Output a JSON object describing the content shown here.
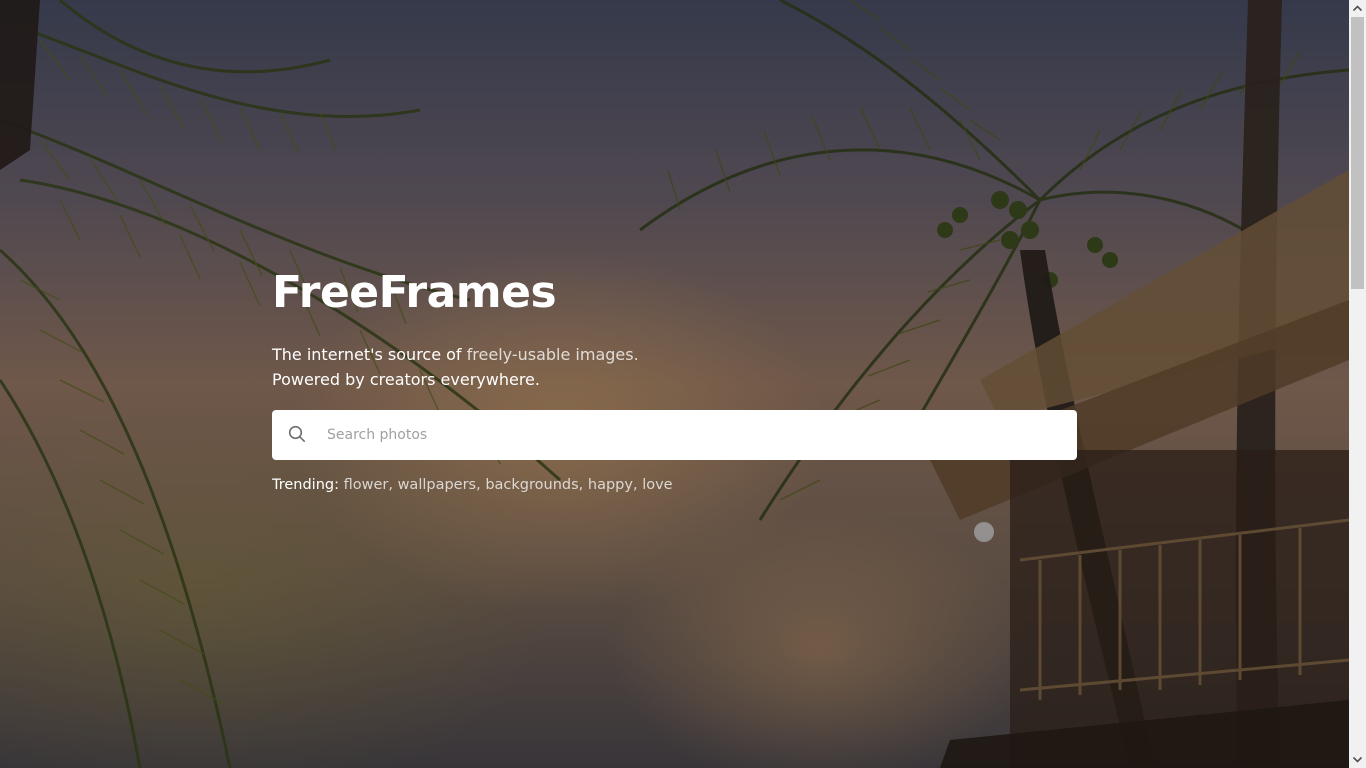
{
  "hero": {
    "brand": "FreeFrames",
    "tagline_part1": "The internet's source of ",
    "tagline_highlight": "freely-usable images.",
    "tagline_line2": "Powered by creators everywhere."
  },
  "search": {
    "placeholder": "Search photos",
    "icon": "search-icon"
  },
  "trending": {
    "label": "Trending:",
    "items": [
      "flower",
      "wallpapers",
      "backgrounds",
      "happy",
      "love"
    ]
  },
  "colors": {
    "text": "#ffffff",
    "muted_text": "#d9d4d0",
    "search_bg": "#ffffff",
    "placeholder": "#a0a0a0"
  }
}
